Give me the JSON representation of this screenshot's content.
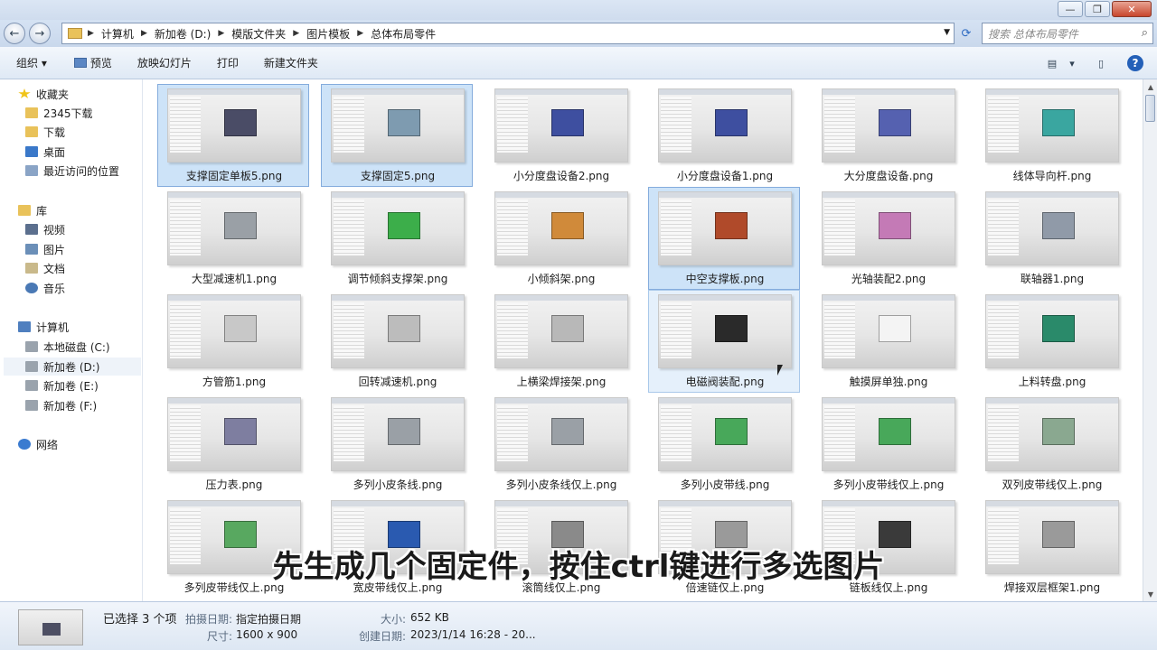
{
  "titlebar": {
    "min": "—",
    "max": "❐",
    "close": "✕"
  },
  "address": {
    "crumbs": [
      "计算机",
      "新加卷 (D:)",
      "模版文件夹",
      "图片模板",
      "总体布局零件"
    ],
    "search_placeholder": "搜索 总体布局零件"
  },
  "toolbar": {
    "organize": "组织 ▾",
    "preview": "预览",
    "slideshow": "放映幻灯片",
    "print": "打印",
    "new_folder": "新建文件夹",
    "help": "?"
  },
  "nav": {
    "favorites": "收藏夹",
    "fav_items": [
      "2345下载",
      "下载",
      "桌面",
      "最近访问的位置"
    ],
    "libraries": "库",
    "lib_items": [
      "视频",
      "图片",
      "文档",
      "音乐"
    ],
    "computer": "计算机",
    "drives": [
      "本地磁盘 (C:)",
      "新加卷 (D:)",
      "新加卷 (E:)",
      "新加卷 (F:)"
    ],
    "network": "网络"
  },
  "files": [
    "支撑固定单板5.png",
    "支撑固定5.png",
    "小分度盘设备2.png",
    "小分度盘设备1.png",
    "大分度盘设备.png",
    "线体导向杆.png",
    "大型减速机1.png",
    "调节倾斜支撑架.png",
    "小倾斜架.png",
    "中空支撑板.png",
    "光轴装配2.png",
    "联轴器1.png",
    "方管筋1.png",
    "回转减速机.png",
    "上横梁焊接架.png",
    "电磁阀装配.png",
    "触摸屏单独.png",
    "上料转盘.png",
    "压力表.png",
    "多列小皮条线.png",
    "多列小皮条线仅上.png",
    "多列小皮带线.png",
    "多列小皮带线仅上.png",
    "双列皮带线仅上.png",
    "多列皮带线仅上.png",
    "宽皮带线仅上.png",
    "滚筒线仅上.png",
    "倍速链仅上.png",
    "链板线仅上.png",
    "焊接双层框架1.png"
  ],
  "details": {
    "selected": "已选择 3 个项",
    "date_label": "拍摄日期:",
    "date_value": "指定拍摄日期",
    "size_label": "大小:",
    "size_value": "652 KB",
    "dim_label": "尺寸:",
    "dim_value": "1600 x 900",
    "created_label": "创建日期:",
    "created_value": "2023/1/14 16:28 - 20..."
  },
  "subtitle": "先生成几个固定件，按住ctrl键进行多选图片"
}
